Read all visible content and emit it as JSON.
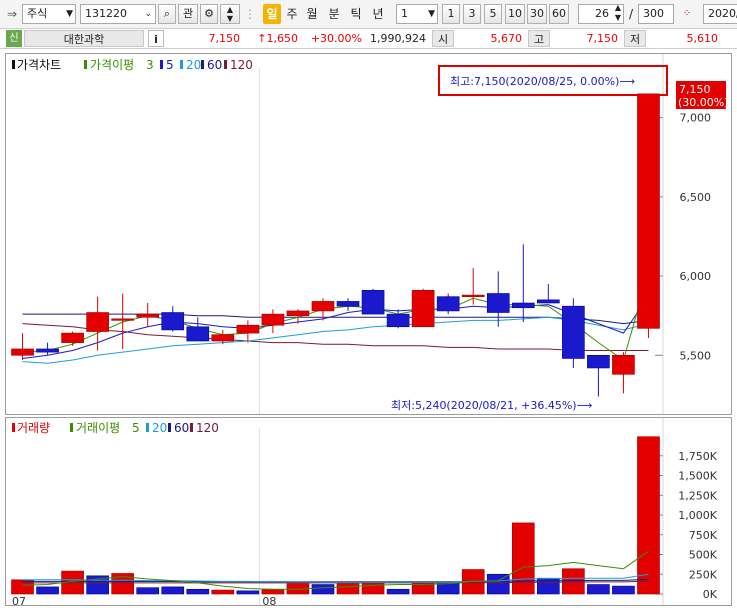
{
  "toolbar": {
    "market_select": "주식",
    "code_input": "131220",
    "btn_gwan": "관",
    "period_tabs": [
      "일",
      "주",
      "월",
      "분",
      "틱",
      "년"
    ],
    "active_period": "일",
    "interval_select": "1",
    "interval_buttons": [
      "1",
      "3",
      "5",
      "10",
      "30",
      "60"
    ],
    "count_value": "26",
    "count_sep": "/",
    "count_total": "300",
    "date_value": "2020/"
  },
  "infobar": {
    "badge": "신",
    "stock_name": "대한과학",
    "info_btn": "i",
    "price": "7,150",
    "change": "↑1,650",
    "change_pct": "+30.00%",
    "volume": "1,990,924",
    "open_label": "시",
    "open_value": "5,670",
    "high_label": "고",
    "high_value": "7,150",
    "low_label": "저",
    "low_value": "5,610"
  },
  "colors": {
    "up": "#e50000",
    "down": "#1a1acc",
    "ma3": "#3a8f00",
    "ma5": "#1a1acc",
    "ma20": "#1c9fd8",
    "ma60": "#1a1a80",
    "ma120": "#7a1a3a"
  },
  "chart_data": [
    {
      "type": "candlestick",
      "legend": {
        "title": "가격차트",
        "ma_label": "가격이평",
        "periods": [
          "3",
          "5",
          "20",
          "60",
          "120"
        ]
      },
      "y_ticks": [
        "7,000",
        "6,500",
        "6,000",
        "5,500"
      ],
      "ylim": [
        5180,
        7250
      ],
      "annotations": {
        "high": "최고:7,150(2020/08/25, 0.00%)⟶",
        "low": "최저:5,240(2020/08/21, +36.45%)⟶"
      },
      "last_price_tag": {
        "price": "7,150",
        "pct": "(30.00%)"
      },
      "candles": [
        {
          "o": 5500,
          "h": 5640,
          "l": 5470,
          "c": 5540
        },
        {
          "o": 5540,
          "h": 5580,
          "l": 5500,
          "c": 5520
        },
        {
          "o": 5580,
          "h": 5650,
          "l": 5560,
          "c": 5640
        },
        {
          "o": 5650,
          "h": 5870,
          "l": 5530,
          "c": 5770
        },
        {
          "o": 5730,
          "h": 5890,
          "l": 5540,
          "c": 5730
        },
        {
          "o": 5740,
          "h": 5830,
          "l": 5680,
          "c": 5760
        },
        {
          "o": 5770,
          "h": 5810,
          "l": 5650,
          "c": 5660
        },
        {
          "o": 5680,
          "h": 5740,
          "l": 5590,
          "c": 5590
        },
        {
          "o": 5590,
          "h": 5660,
          "l": 5570,
          "c": 5630
        },
        {
          "o": 5640,
          "h": 5720,
          "l": 5580,
          "c": 5690
        },
        {
          "o": 5690,
          "h": 5790,
          "l": 5640,
          "c": 5760
        },
        {
          "o": 5750,
          "h": 5790,
          "l": 5700,
          "c": 5780
        },
        {
          "o": 5780,
          "h": 5860,
          "l": 5720,
          "c": 5840
        },
        {
          "o": 5840,
          "h": 5860,
          "l": 5780,
          "c": 5810
        },
        {
          "o": 5910,
          "h": 5920,
          "l": 5770,
          "c": 5760
        },
        {
          "o": 5760,
          "h": 5790,
          "l": 5670,
          "c": 5680
        },
        {
          "o": 5680,
          "h": 5920,
          "l": 5680,
          "c": 5910
        },
        {
          "o": 5870,
          "h": 5890,
          "l": 5760,
          "c": 5780
        },
        {
          "o": 5870,
          "h": 6050,
          "l": 5820,
          "c": 5880
        },
        {
          "o": 5890,
          "h": 6030,
          "l": 5680,
          "c": 5770
        },
        {
          "o": 5830,
          "h": 6200,
          "l": 5710,
          "c": 5800
        },
        {
          "o": 5850,
          "h": 5950,
          "l": 5840,
          "c": 5830
        },
        {
          "o": 5810,
          "h": 5860,
          "l": 5420,
          "c": 5480
        },
        {
          "o": 5500,
          "h": 5500,
          "l": 5240,
          "c": 5420
        },
        {
          "o": 5380,
          "h": 5520,
          "l": 5260,
          "c": 5500
        },
        {
          "o": 5670,
          "h": 7150,
          "l": 5610,
          "c": 7150
        }
      ],
      "ma_lines": {
        "ma3": [
          5520,
          5530,
          5570,
          5640,
          5710,
          5750,
          5720,
          5670,
          5630,
          5640,
          5700,
          5740,
          5790,
          5810,
          5800,
          5760,
          5790,
          5790,
          5860,
          5820,
          5820,
          5810,
          5700,
          5580,
          5470,
          6020
        ],
        "ma5": [
          5480,
          5500,
          5530,
          5580,
          5640,
          5680,
          5710,
          5700,
          5680,
          5670,
          5690,
          5710,
          5730,
          5770,
          5790,
          5780,
          5790,
          5790,
          5810,
          5800,
          5810,
          5820,
          5760,
          5700,
          5640,
          5870
        ],
        "ma20": [
          5460,
          5450,
          5470,
          5500,
          5520,
          5540,
          5560,
          5570,
          5580,
          5590,
          5610,
          5630,
          5650,
          5660,
          5680,
          5690,
          5700,
          5710,
          5720,
          5720,
          5730,
          5740,
          5720,
          5690,
          5660,
          5700
        ],
        "ma60": [
          5760,
          5760,
          5760,
          5760,
          5760,
          5760,
          5760,
          5750,
          5750,
          5740,
          5740,
          5740,
          5740,
          5740,
          5740,
          5740,
          5740,
          5740,
          5740,
          5740,
          5740,
          5740,
          5730,
          5720,
          5700,
          5720
        ],
        "ma120": [
          5700,
          5690,
          5680,
          5660,
          5650,
          5630,
          5620,
          5610,
          5600,
          5590,
          5580,
          5580,
          5570,
          5570,
          5560,
          5560,
          5560,
          5550,
          5550,
          5540,
          5540,
          5540,
          5530,
          5530,
          5530,
          5530
        ]
      }
    },
    {
      "type": "bar",
      "legend": {
        "title": "거래량",
        "ma_label": "거래이평",
        "periods": [
          "5",
          "20",
          "60",
          "120"
        ]
      },
      "y_ticks": [
        "1,750K",
        "1,500K",
        "1,250K",
        "1,000K",
        "750K",
        "500K",
        "250K",
        "0K"
      ],
      "ylim": [
        0,
        2000000
      ],
      "x_labels": [
        {
          "index": 0,
          "label": "07"
        },
        {
          "index": 10,
          "label": "08"
        }
      ],
      "values": [
        180000,
        90000,
        290000,
        230000,
        260000,
        80000,
        90000,
        60000,
        50000,
        40000,
        60000,
        130000,
        120000,
        130000,
        150000,
        60000,
        150000,
        140000,
        310000,
        250000,
        900000,
        200000,
        320000,
        120000,
        100000,
        1990924
      ],
      "up_flags": [
        true,
        false,
        true,
        false,
        true,
        false,
        false,
        false,
        true,
        false,
        true,
        true,
        false,
        true,
        true,
        false,
        true,
        false,
        true,
        false,
        true,
        false,
        true,
        false,
        false,
        true
      ],
      "ma_lines": {
        "ma5": [
          110000,
          120000,
          160000,
          190000,
          220000,
          190000,
          170000,
          140000,
          100000,
          70000,
          60000,
          60000,
          80000,
          90000,
          110000,
          120000,
          120000,
          130000,
          160000,
          170000,
          340000,
          360000,
          400000,
          360000,
          320000,
          540000
        ],
        "ma20": [
          180000,
          180000,
          180000,
          175000,
          175000,
          170000,
          170000,
          165000,
          160000,
          160000,
          155000,
          155000,
          150000,
          150000,
          150000,
          150000,
          150000,
          150000,
          160000,
          165000,
          190000,
          195000,
          200000,
          200000,
          200000,
          250000
        ],
        "ma60": [
          160000,
          160000,
          160000,
          160000,
          160000,
          158000,
          158000,
          156000,
          156000,
          155000,
          155000,
          154000,
          154000,
          154000,
          154000,
          154000,
          155000,
          155000,
          157000,
          158000,
          165000,
          168000,
          170000,
          172000,
          172000,
          185000
        ],
        "ma120": [
          140000,
          140000,
          140000,
          140000,
          140000,
          140000,
          140000,
          140000,
          140000,
          140000,
          140000,
          140000,
          140000,
          140000,
          140000,
          140000,
          140000,
          140000,
          142000,
          142000,
          148000,
          150000,
          152000,
          153000,
          153000,
          165000
        ]
      }
    }
  ]
}
